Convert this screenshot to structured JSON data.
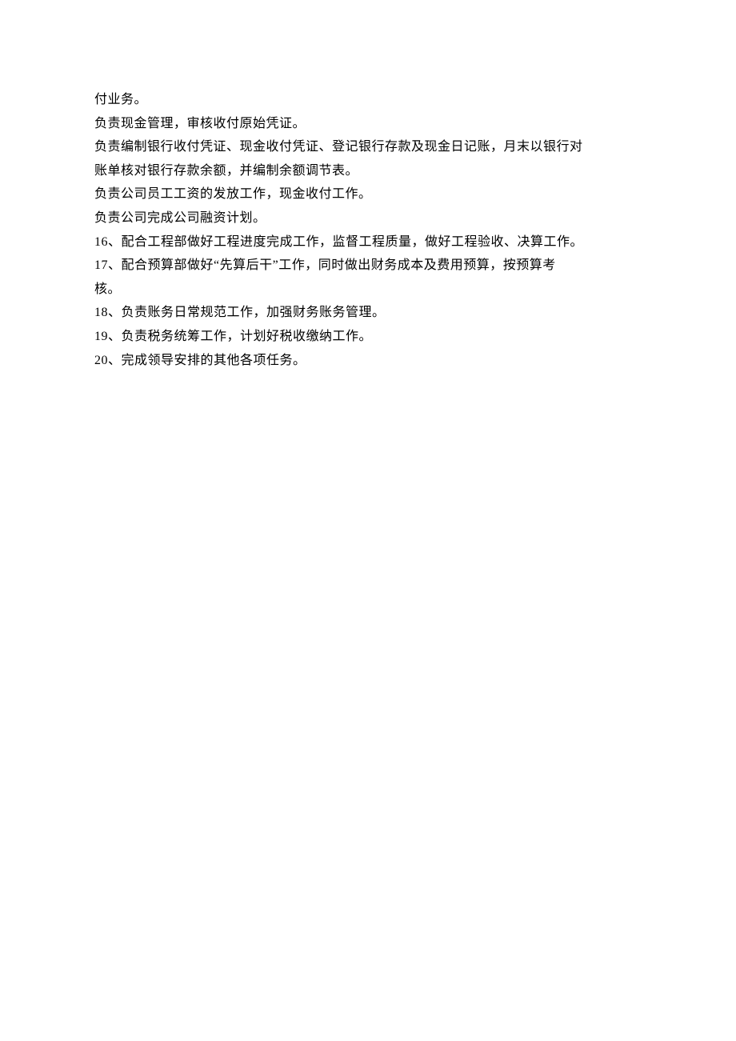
{
  "lines": [
    {
      "text": "付业务。",
      "indent": false
    },
    {
      "text": "负责现金管理，审核收付原始凭证。",
      "indent": false
    },
    {
      "text": "  负责编制银行收付凭证、现金收付凭证、登记银行存款及现金日记账，月末以银行对",
      "indent": false
    },
    {
      "text": "账单核对银行存款余额，并编制余额调节表。",
      "indent": false
    },
    {
      "text": "负责公司员工工资的发放工作，现金收付工作。",
      "indent": false
    },
    {
      "text": "负责公司完成公司融资计划。",
      "indent": false
    },
    {
      "text": "  16、配合工程部做好工程进度完成工作，监督工程质量，做好工程验收、决算工作。",
      "indent": false
    },
    {
      "text": "  17、配合预算部做好“先算后干”工作，同时做出财务成本及费用预算，按预算考",
      "indent": false
    },
    {
      "text": "核。",
      "indent": false
    },
    {
      "text": "18、负责账务日常规范工作，加强财务账务管理。",
      "indent": false
    },
    {
      "text": "19、负责税务统筹工作，计划好税收缴纳工作。",
      "indent": false
    },
    {
      "text": "20、完成领导安排的其他各项任务。",
      "indent": false
    }
  ]
}
